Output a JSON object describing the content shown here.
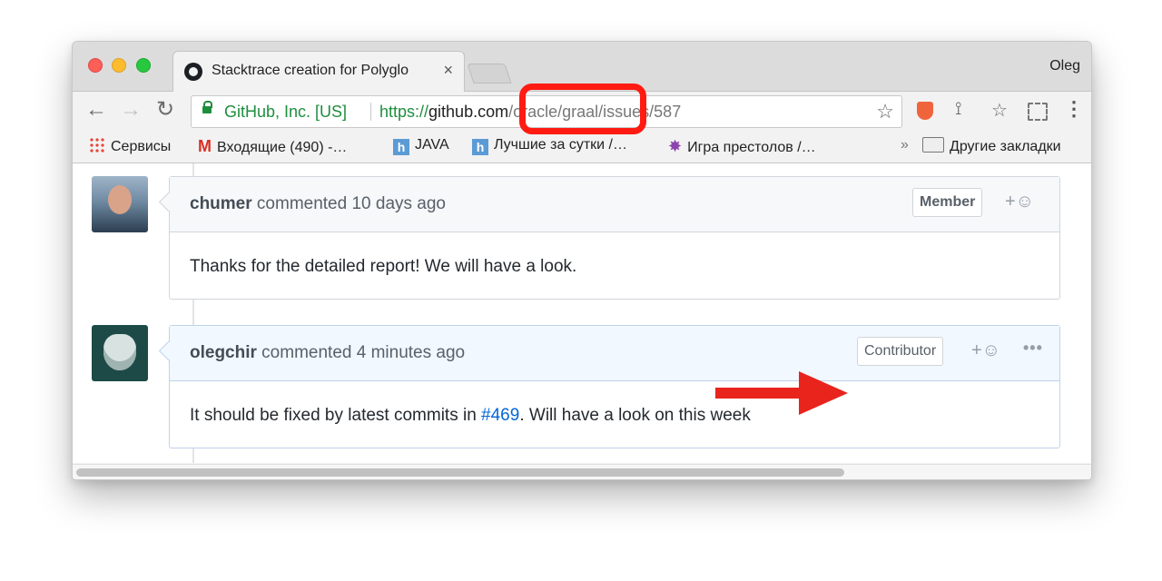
{
  "browser": {
    "tab_title": "Stacktrace creation for Polyglo",
    "tab_close": "×",
    "user": "Oleg",
    "address": {
      "secure_label": "GitHub, Inc. [US]",
      "scheme": "https://",
      "host": "github.com",
      "path": "/oracle/graal/issues/587"
    },
    "nav": {
      "back": "←",
      "forward": "→",
      "reload": "↻"
    },
    "star_icon": "☆",
    "bookmarks": [
      {
        "label": "Сервисы",
        "icon": "apps-grid-icon"
      },
      {
        "label": "Входящие (490) -…",
        "icon": "gmail-icon"
      },
      {
        "label": "JAVA",
        "icon": "h-icon"
      },
      {
        "label": "Лучшие за сутки /…",
        "icon": "h-icon"
      },
      {
        "label": "Игра престолов /…",
        "icon": "star-burst-icon"
      }
    ],
    "bookmarks_overflow": "»",
    "other_bookmarks": "Другие закладки"
  },
  "comments": [
    {
      "author": "chumer",
      "meta": " commented 10 days ago",
      "badge": "Member",
      "body": "Thanks for the detailed report! We will have a look."
    },
    {
      "author": "olegchir",
      "meta": " commented 4 minutes ago",
      "badge": "Contributor",
      "body_before": "It should be fixed by latest commits in ",
      "link": "#469",
      "body_after": ". Will have a look on this week"
    }
  ],
  "reaction_label": "+☺",
  "more_label": "•••",
  "colors": {
    "annotation_red": "#e8241d",
    "secure_green": "#1e8e3e",
    "link_blue": "#0366d6"
  }
}
